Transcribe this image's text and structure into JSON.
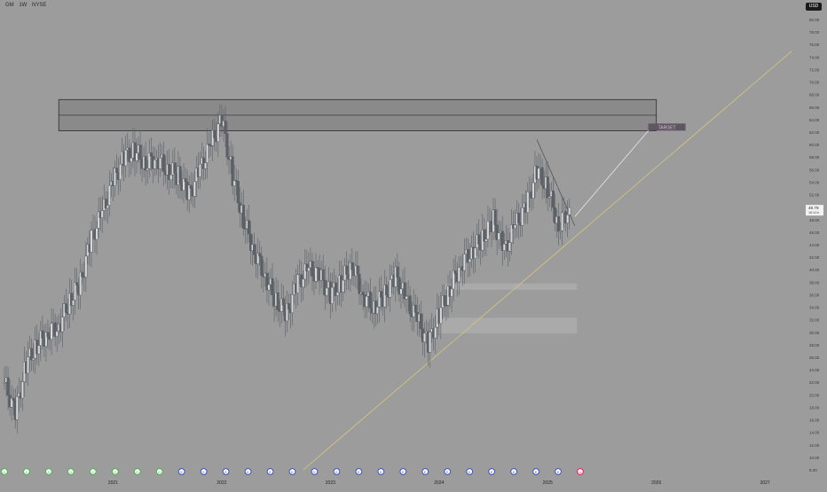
{
  "header": {
    "symbol": "GM",
    "interval": "1W",
    "exchange": "NYSE",
    "currency": "USD"
  },
  "price_axis": {
    "ticks": [
      "80.00",
      "78.00",
      "76.00",
      "74.00",
      "72.00",
      "70.00",
      "68.00",
      "66.00",
      "64.00",
      "62.00",
      "60.00",
      "58.00",
      "56.00",
      "54.00",
      "52.00",
      "50.00",
      "48.00",
      "46.00",
      "44.00",
      "42.00",
      "40.00",
      "38.00",
      "36.00",
      "34.00",
      "32.00",
      "30.00",
      "28.00",
      "26.00",
      "24.00",
      "22.00",
      "20.00",
      "18.00",
      "16.00",
      "14.00",
      "12.00",
      "10.00",
      "8.00"
    ],
    "last_price": "49.79",
    "countdown": "16:11h"
  },
  "time_axis": {
    "labels": [
      "2021",
      "2022",
      "2023",
      "2024",
      "2025",
      "2026",
      "2027"
    ]
  },
  "annotations": {
    "target_label": "TARGET"
  },
  "colors": {
    "background": "#9c9c9c",
    "candle": "#5a6066",
    "zone_fill": "#8a8a8a",
    "trendline": "#d8c87a",
    "target_box": "#5e5660",
    "target_text": "#e8b8e8",
    "event_dividend": "#4caf50",
    "event_earnings": "#3f51b5",
    "event_upcoming": "#e91e63"
  },
  "chart_data": {
    "type": "candlestick",
    "title": "",
    "ylim": [
      8,
      80
    ],
    "x": [
      2020.0,
      2020.1,
      2020.2,
      2020.3,
      2020.4,
      2020.5,
      2020.6,
      2020.7,
      2020.8,
      2020.9,
      2021.0,
      2021.1,
      2021.2,
      2021.3,
      2021.4,
      2021.5,
      2021.6,
      2021.7,
      2021.8,
      2021.9,
      2022.0,
      2022.1,
      2022.2,
      2022.3,
      2022.4,
      2022.5,
      2022.6,
      2022.7,
      2022.8,
      2022.9,
      2023.0,
      2023.1,
      2023.2,
      2023.3,
      2023.4,
      2023.5,
      2023.6,
      2023.7,
      2023.8,
      2023.9,
      2024.0,
      2024.1,
      2024.2,
      2024.3,
      2024.4,
      2024.5,
      2024.6,
      2024.7,
      2024.8,
      2024.9,
      2025.0,
      2025.1,
      2025.2
    ],
    "close": [
      22.0,
      17.0,
      25.0,
      28.0,
      30.0,
      31.0,
      35.0,
      38.0,
      45.0,
      49.0,
      54.0,
      58.0,
      59.0,
      57.0,
      58.0,
      56.0,
      55.0,
      52.0,
      56.0,
      60.0,
      64.0,
      55.0,
      48.0,
      43.0,
      39.0,
      35.0,
      33.0,
      38.0,
      40.0,
      39.0,
      36.0,
      38.0,
      41.0,
      36.0,
      34.0,
      36.0,
      39.0,
      35.0,
      32.0,
      28.0,
      33.0,
      37.0,
      41.0,
      43.0,
      45.0,
      48.0,
      43.0,
      47.0,
      50.0,
      56.0,
      53.0,
      47.0,
      49.8
    ],
    "events": [
      "D",
      "D",
      "D",
      "D",
      "D",
      "D",
      "D",
      "D",
      "E",
      "E",
      "E",
      "E",
      "E",
      "E",
      "E",
      "E",
      "E",
      "E",
      "E",
      "E",
      "E",
      "E",
      "E",
      "E",
      "E",
      "E",
      "U"
    ],
    "trendline": {
      "start": [
        2022.75,
        8
      ],
      "end": [
        2027.25,
        75
      ]
    },
    "resistance_zone": {
      "from": 62.2,
      "to": 67.2,
      "x0": 2020.5,
      "x1": 2026.0
    },
    "target": {
      "price": 62.8,
      "x": 2025.95
    }
  }
}
